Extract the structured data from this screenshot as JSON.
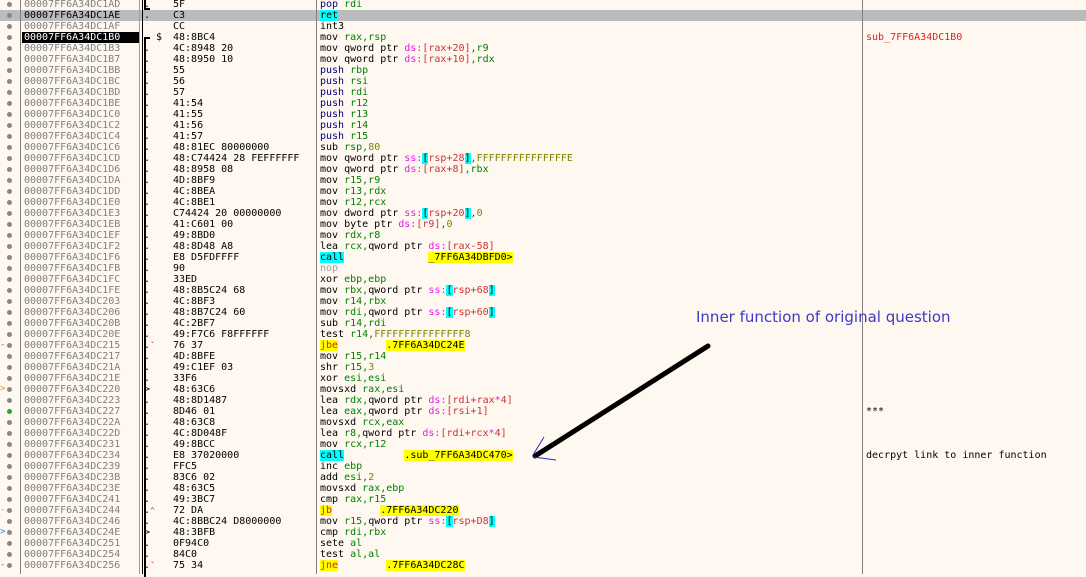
{
  "rows": [
    {
      "addr": "00007FF6A34DC1AD",
      "mark": ".",
      "bytes": "5F",
      "instr": [
        [
          "m",
          "pop "
        ],
        [
          "g",
          "rdi"
        ]
      ]
    },
    {
      "addr": "00007FF6A34DC1AE",
      "mark": ".",
      "bytes": "C3",
      "instr": [
        [
          "cy",
          "ret"
        ]
      ],
      "selected": true,
      "addr_style": "hl"
    },
    {
      "addr": "00007FF6A34DC1AF",
      "mark": "",
      "bytes": "CC",
      "instr": [
        [
          "k",
          "int3"
        ]
      ]
    },
    {
      "addr": "00007FF6A34DC1B0",
      "mark": "$",
      "bytes": "48:8BC4",
      "instr": [
        [
          "k",
          "mov "
        ],
        [
          "g",
          "rax,rsp"
        ]
      ],
      "addr_style": "cur",
      "comment": "sub_7FF6A34DC1B0",
      "comment_style": "red"
    },
    {
      "addr": "00007FF6A34DC1B3",
      "mark": ".",
      "bytes": "4C:8948 20",
      "instr": [
        [
          "k",
          "mov qword ptr "
        ],
        [
          "p",
          "ds:"
        ],
        [
          "r",
          "[rax+20]"
        ],
        [
          "g",
          ",r9"
        ]
      ]
    },
    {
      "addr": "00007FF6A34DC1B7",
      "mark": ".",
      "bytes": "48:8950 10",
      "instr": [
        [
          "k",
          "mov qword ptr "
        ],
        [
          "p",
          "ds:"
        ],
        [
          "r",
          "[rax+10]"
        ],
        [
          "g",
          ",rdx"
        ]
      ]
    },
    {
      "addr": "00007FF6A34DC1BB",
      "mark": ".",
      "bytes": "55",
      "instr": [
        [
          "m",
          "push "
        ],
        [
          "g",
          "rbp"
        ]
      ]
    },
    {
      "addr": "00007FF6A34DC1BC",
      "mark": ".",
      "bytes": "56",
      "instr": [
        [
          "m",
          "push "
        ],
        [
          "g",
          "rsi"
        ]
      ]
    },
    {
      "addr": "00007FF6A34DC1BD",
      "mark": ".",
      "bytes": "57",
      "instr": [
        [
          "m",
          "push "
        ],
        [
          "g",
          "rdi"
        ]
      ]
    },
    {
      "addr": "00007FF6A34DC1BE",
      "mark": ".",
      "bytes": "41:54",
      "instr": [
        [
          "m",
          "push "
        ],
        [
          "g",
          "r12"
        ]
      ]
    },
    {
      "addr": "00007FF6A34DC1C0",
      "mark": ".",
      "bytes": "41:55",
      "instr": [
        [
          "m",
          "push "
        ],
        [
          "g",
          "r13"
        ]
      ]
    },
    {
      "addr": "00007FF6A34DC1C2",
      "mark": ".",
      "bytes": "41:56",
      "instr": [
        [
          "m",
          "push "
        ],
        [
          "g",
          "r14"
        ]
      ]
    },
    {
      "addr": "00007FF6A34DC1C4",
      "mark": ".",
      "bytes": "41:57",
      "instr": [
        [
          "m",
          "push "
        ],
        [
          "g",
          "r15"
        ]
      ]
    },
    {
      "addr": "00007FF6A34DC1C6",
      "mark": ".",
      "bytes": "48:81EC 80000000",
      "instr": [
        [
          "k",
          "sub "
        ],
        [
          "g",
          "rsp,"
        ],
        [
          "o",
          "80"
        ]
      ]
    },
    {
      "addr": "00007FF6A34DC1CD",
      "mark": ".",
      "bytes": "48:C74424 28 FEFFFFFF",
      "instr": [
        [
          "k",
          "mov qword ptr "
        ],
        [
          "p",
          "ss:"
        ],
        [
          "cy",
          "["
        ],
        [
          "r",
          "rsp+28"
        ],
        [
          "cy",
          "]"
        ],
        [
          "g",
          ","
        ],
        [
          "o",
          "FFFFFFFFFFFFFFFE"
        ]
      ]
    },
    {
      "addr": "00007FF6A34DC1D6",
      "mark": ".",
      "bytes": "48:8958 08",
      "instr": [
        [
          "k",
          "mov qword ptr "
        ],
        [
          "p",
          "ds:"
        ],
        [
          "r",
          "[rax+8]"
        ],
        [
          "g",
          ",rbx"
        ]
      ]
    },
    {
      "addr": "00007FF6A34DC1DA",
      "mark": ".",
      "bytes": "4D:8BF9",
      "instr": [
        [
          "k",
          "mov "
        ],
        [
          "g",
          "r15,r9"
        ]
      ]
    },
    {
      "addr": "00007FF6A34DC1DD",
      "mark": ".",
      "bytes": "4C:8BEA",
      "instr": [
        [
          "k",
          "mov "
        ],
        [
          "g",
          "r13,rdx"
        ]
      ]
    },
    {
      "addr": "00007FF6A34DC1E0",
      "mark": ".",
      "bytes": "4C:8BE1",
      "instr": [
        [
          "k",
          "mov "
        ],
        [
          "g",
          "r12,rcx"
        ]
      ]
    },
    {
      "addr": "00007FF6A34DC1E3",
      "mark": ".",
      "bytes": "C74424 20 00000000",
      "instr": [
        [
          "k",
          "mov dword ptr "
        ],
        [
          "p",
          "ss:"
        ],
        [
          "cy",
          "["
        ],
        [
          "r",
          "rsp+20"
        ],
        [
          "cy",
          "]"
        ],
        [
          "g",
          ","
        ],
        [
          "o",
          "0"
        ]
      ]
    },
    {
      "addr": "00007FF6A34DC1EB",
      "mark": ".",
      "bytes": "41:C601 00",
      "instr": [
        [
          "k",
          "mov byte ptr "
        ],
        [
          "p",
          "ds:"
        ],
        [
          "r",
          "[r9]"
        ],
        [
          "g",
          ","
        ],
        [
          "o",
          "0"
        ]
      ]
    },
    {
      "addr": "00007FF6A34DC1EF",
      "mark": ".",
      "bytes": "49:8BD0",
      "instr": [
        [
          "k",
          "mov "
        ],
        [
          "g",
          "rdx,r8"
        ]
      ]
    },
    {
      "addr": "00007FF6A34DC1F2",
      "mark": ".",
      "bytes": "48:8D48 A8",
      "instr": [
        [
          "k",
          "lea "
        ],
        [
          "g",
          "rcx,"
        ],
        [
          "k",
          "qword ptr "
        ],
        [
          "p",
          "ds:"
        ],
        [
          "r",
          "[rax-58]"
        ]
      ]
    },
    {
      "addr": "00007FF6A34DC1F6",
      "mark": ".",
      "bytes": "E8 D5FDFFFF",
      "instr": [
        [
          "cy",
          "call"
        ],
        [
          "k",
          "              "
        ],
        [
          "ye",
          "_7FF6A34DBFD0>"
        ]
      ]
    },
    {
      "addr": "00007FF6A34DC1FB",
      "mark": ".",
      "bytes": "90",
      "instr": [
        [
          "gray",
          "nop"
        ]
      ]
    },
    {
      "addr": "00007FF6A34DC1FC",
      "mark": ".",
      "bytes": "33ED",
      "instr": [
        [
          "k",
          "xor "
        ],
        [
          "g",
          "ebp,ebp"
        ]
      ]
    },
    {
      "addr": "00007FF6A34DC1FE",
      "mark": ".",
      "bytes": "48:8B5C24 68",
      "instr": [
        [
          "k",
          "mov "
        ],
        [
          "g",
          "rbx,"
        ],
        [
          "k",
          "qword ptr "
        ],
        [
          "p",
          "ss:"
        ],
        [
          "cy",
          "["
        ],
        [
          "r",
          "rsp+68"
        ],
        [
          "cy",
          "]"
        ]
      ]
    },
    {
      "addr": "00007FF6A34DC203",
      "mark": ".",
      "bytes": "4C:8BF3",
      "instr": [
        [
          "k",
          "mov "
        ],
        [
          "g",
          "r14,rbx"
        ]
      ]
    },
    {
      "addr": "00007FF6A34DC206",
      "mark": ".",
      "bytes": "48:8B7C24 60",
      "instr": [
        [
          "k",
          "mov "
        ],
        [
          "g",
          "rdi,"
        ],
        [
          "k",
          "qword ptr "
        ],
        [
          "p",
          "ss:"
        ],
        [
          "cy",
          "["
        ],
        [
          "r",
          "rsp+60"
        ],
        [
          "cy",
          "]"
        ]
      ]
    },
    {
      "addr": "00007FF6A34DC20B",
      "mark": ".",
      "bytes": "4C:2BF7",
      "instr": [
        [
          "k",
          "sub "
        ],
        [
          "g",
          "r14,rdi"
        ]
      ]
    },
    {
      "addr": "00007FF6A34DC20E",
      "mark": ".",
      "bytes": "49:F7C6 F8FFFFFF",
      "instr": [
        [
          "k",
          "test "
        ],
        [
          "g",
          "r14,"
        ],
        [
          "o",
          "FFFFFFFFFFFFFFF8"
        ]
      ]
    },
    {
      "addr": "00007FF6A34DC215",
      "mark": ".v",
      "bytes": "76 37",
      "instr": [
        [
          "yr",
          "jbe"
        ],
        [
          "k",
          "        "
        ],
        [
          "ye",
          ".7FF6A34DC24E"
        ]
      ],
      "gutter": "-"
    },
    {
      "addr": "00007FF6A34DC217",
      "mark": ".",
      "bytes": "4D:8BFE",
      "instr": [
        [
          "k",
          "mov "
        ],
        [
          "g",
          "r15,r14"
        ]
      ]
    },
    {
      "addr": "00007FF6A34DC21A",
      "mark": ".",
      "bytes": "49:C1EF 03",
      "instr": [
        [
          "k",
          "shr "
        ],
        [
          "g",
          "r15,"
        ],
        [
          "o",
          "3"
        ]
      ]
    },
    {
      "addr": "00007FF6A34DC21E",
      "mark": ".",
      "bytes": "33F6",
      "instr": [
        [
          "k",
          "xor "
        ],
        [
          "g",
          "esi,esi"
        ]
      ]
    },
    {
      "addr": "00007FF6A34DC220",
      "mark": ">",
      "bytes": "48:63C6",
      "instr": [
        [
          "k",
          "movsxd "
        ],
        [
          "g",
          "rax,esi"
        ]
      ],
      "gutter": ">o"
    },
    {
      "addr": "00007FF6A34DC223",
      "mark": ".",
      "bytes": "48:8D1487",
      "instr": [
        [
          "k",
          "lea "
        ],
        [
          "g",
          "rdx,"
        ],
        [
          "k",
          "qword ptr "
        ],
        [
          "p",
          "ds:"
        ],
        [
          "r",
          "[rdi+rax"
        ],
        [
          "p",
          "*"
        ],
        [
          "r",
          "4]"
        ]
      ]
    },
    {
      "addr": "00007FF6A34DC227",
      "mark": ".",
      "bytes": "8D46 01",
      "instr": [
        [
          "k",
          "lea "
        ],
        [
          "g",
          "eax,"
        ],
        [
          "k",
          "qword ptr "
        ],
        [
          "p",
          "ds:"
        ],
        [
          "r",
          "[rsi+1]"
        ]
      ],
      "dot": "green",
      "comment": "***"
    },
    {
      "addr": "00007FF6A34DC22A",
      "mark": ".",
      "bytes": "48:63C8",
      "instr": [
        [
          "k",
          "movsxd "
        ],
        [
          "g",
          "rcx,eax"
        ]
      ]
    },
    {
      "addr": "00007FF6A34DC22D",
      "mark": ".",
      "bytes": "4C:8D048F",
      "instr": [
        [
          "k",
          "lea "
        ],
        [
          "g",
          "r8,"
        ],
        [
          "k",
          "qword ptr "
        ],
        [
          "p",
          "ds:"
        ],
        [
          "r",
          "[rdi+rcx"
        ],
        [
          "p",
          "*"
        ],
        [
          "r",
          "4]"
        ]
      ]
    },
    {
      "addr": "00007FF6A34DC231",
      "mark": ".",
      "bytes": "49:8BCC",
      "instr": [
        [
          "k",
          "mov "
        ],
        [
          "g",
          "rcx,r12"
        ]
      ]
    },
    {
      "addr": "00007FF6A34DC234",
      "mark": ".",
      "bytes": "E8 37020000",
      "instr": [
        [
          "cy",
          "call"
        ],
        [
          "k",
          "          "
        ],
        [
          "ye",
          ".sub_7FF6A34DC470>"
        ]
      ],
      "comment": "decrpyt link to inner function"
    },
    {
      "addr": "00007FF6A34DC239",
      "mark": ".",
      "bytes": "FFC5",
      "instr": [
        [
          "k",
          "inc "
        ],
        [
          "g",
          "ebp"
        ]
      ]
    },
    {
      "addr": "00007FF6A34DC23B",
      "mark": ".",
      "bytes": "83C6 02",
      "instr": [
        [
          "k",
          "add "
        ],
        [
          "g",
          "esi,"
        ],
        [
          "o",
          "2"
        ]
      ]
    },
    {
      "addr": "00007FF6A34DC23E",
      "mark": ".",
      "bytes": "48:63C5",
      "instr": [
        [
          "k",
          "movsxd "
        ],
        [
          "g",
          "rax,ebp"
        ]
      ]
    },
    {
      "addr": "00007FF6A34DC241",
      "mark": ".",
      "bytes": "49:3BC7",
      "instr": [
        [
          "k",
          "cmp "
        ],
        [
          "g",
          "rax,r15"
        ]
      ]
    },
    {
      "addr": "00007FF6A34DC244",
      "mark": ".^",
      "bytes": "72 DA",
      "instr": [
        [
          "yr",
          "jb"
        ],
        [
          "k",
          "        "
        ],
        [
          "ye",
          ".7FF6A34DC220"
        ]
      ],
      "gutter": "-o"
    },
    {
      "addr": "00007FF6A34DC246",
      "mark": ".",
      "bytes": "4C:8BBC24 D8000000",
      "instr": [
        [
          "k",
          "mov "
        ],
        [
          "g",
          "r15,"
        ],
        [
          "k",
          "qword ptr "
        ],
        [
          "p",
          "ss:"
        ],
        [
          "cy",
          "["
        ],
        [
          "r",
          "rsp+D8"
        ],
        [
          "cy",
          "]"
        ]
      ]
    },
    {
      "addr": "00007FF6A34DC24E",
      "mark": ">",
      "bytes": "48:3BFB",
      "instr": [
        [
          "k",
          "cmp "
        ],
        [
          "g",
          "rdi,rbx"
        ]
      ],
      "gutter": ">b"
    },
    {
      "addr": "00007FF6A34DC251",
      "mark": ".",
      "bytes": "0F94C0",
      "instr": [
        [
          "k",
          "sete "
        ],
        [
          "g",
          "al"
        ]
      ]
    },
    {
      "addr": "00007FF6A34DC254",
      "mark": ".",
      "bytes": "84C0",
      "instr": [
        [
          "k",
          "test "
        ],
        [
          "g",
          "al,al"
        ]
      ]
    },
    {
      "addr": "00007FF6A34DC256",
      "mark": ".v",
      "bytes": "75 34",
      "instr": [
        [
          "yr",
          "jne"
        ],
        [
          "k",
          "        "
        ],
        [
          "ye",
          ".7FF6A34DC28C"
        ]
      ],
      "gutter": "-"
    }
  ],
  "annotation": {
    "text": "Inner function of original question",
    "color": "#3a3ac8"
  }
}
